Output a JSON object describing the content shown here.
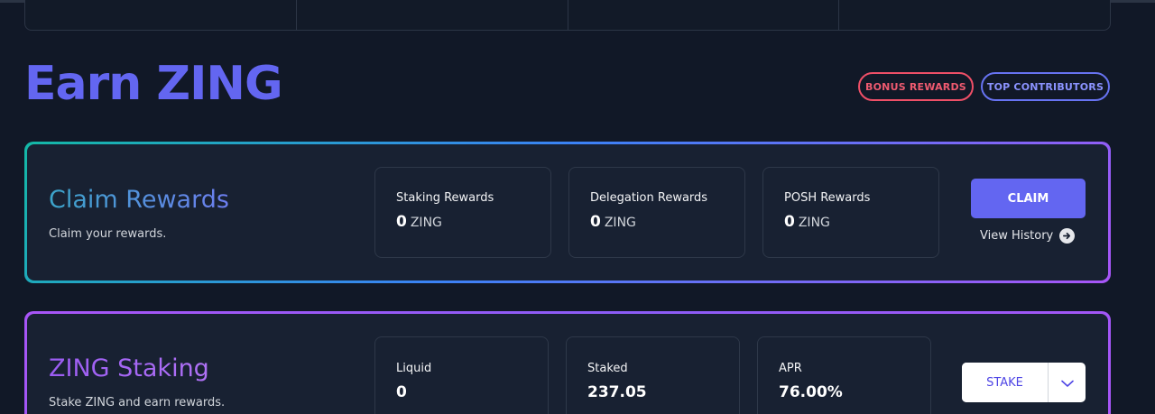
{
  "header": {
    "title": "Earn ZING",
    "pills": {
      "bonus": "BONUS REWARDS",
      "top": "TOP CONTRIBUTORS"
    }
  },
  "claim": {
    "title": "Claim Rewards",
    "subtitle": "Claim your rewards.",
    "cards": [
      {
        "label": "Staking Rewards",
        "value": "0",
        "unit": "ZING"
      },
      {
        "label": "Delegation Rewards",
        "value": "0",
        "unit": "ZING"
      },
      {
        "label": "POSH Rewards",
        "value": "0",
        "unit": "ZING"
      }
    ],
    "button": "CLAIM",
    "history": "View History"
  },
  "staking": {
    "title": "ZING Staking",
    "subtitle": "Stake ZING and earn rewards.",
    "cards": [
      {
        "label": "Liquid",
        "value": "0"
      },
      {
        "label": "Staked",
        "value": "237.05"
      },
      {
        "label": "APR",
        "value": "76.00%"
      }
    ],
    "button": "STAKE"
  },
  "icons": {
    "history": "arrow-right-circle-icon",
    "dropdown": "chevron-down-icon"
  }
}
